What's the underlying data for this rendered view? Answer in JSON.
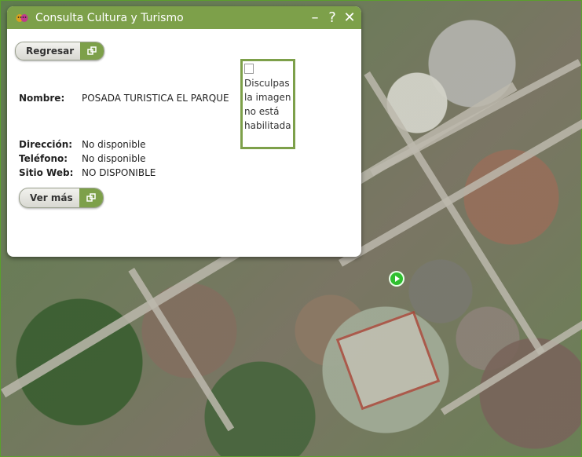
{
  "popup": {
    "title": "Consulta Cultura y Turismo",
    "minimize_label": "–",
    "help_label": "?",
    "close_label": "✕",
    "back_button_label": "Regresar",
    "more_button_label": "Ver más",
    "fields": {
      "nombre_label": "Nombre:",
      "nombre_value": "POSADA TURISTICA EL PARQUE",
      "direccion_label": "Dirección:",
      "direccion_value": "No disponible",
      "telefono_label": "Teléfono:",
      "telefono_value": "No disponible",
      "sitio_label": "Sitio Web:",
      "sitio_value": "NO DISPONIBLE"
    },
    "image_alt": "Disculpas la imagen no está habilitada"
  },
  "colors": {
    "header": "#7da04a",
    "border": "#5aa02c",
    "marker": "#2fbf2f"
  },
  "icons": {
    "app": "theater-masks-icon",
    "button": "external-window-icon",
    "marker": "map-marker-icon"
  }
}
